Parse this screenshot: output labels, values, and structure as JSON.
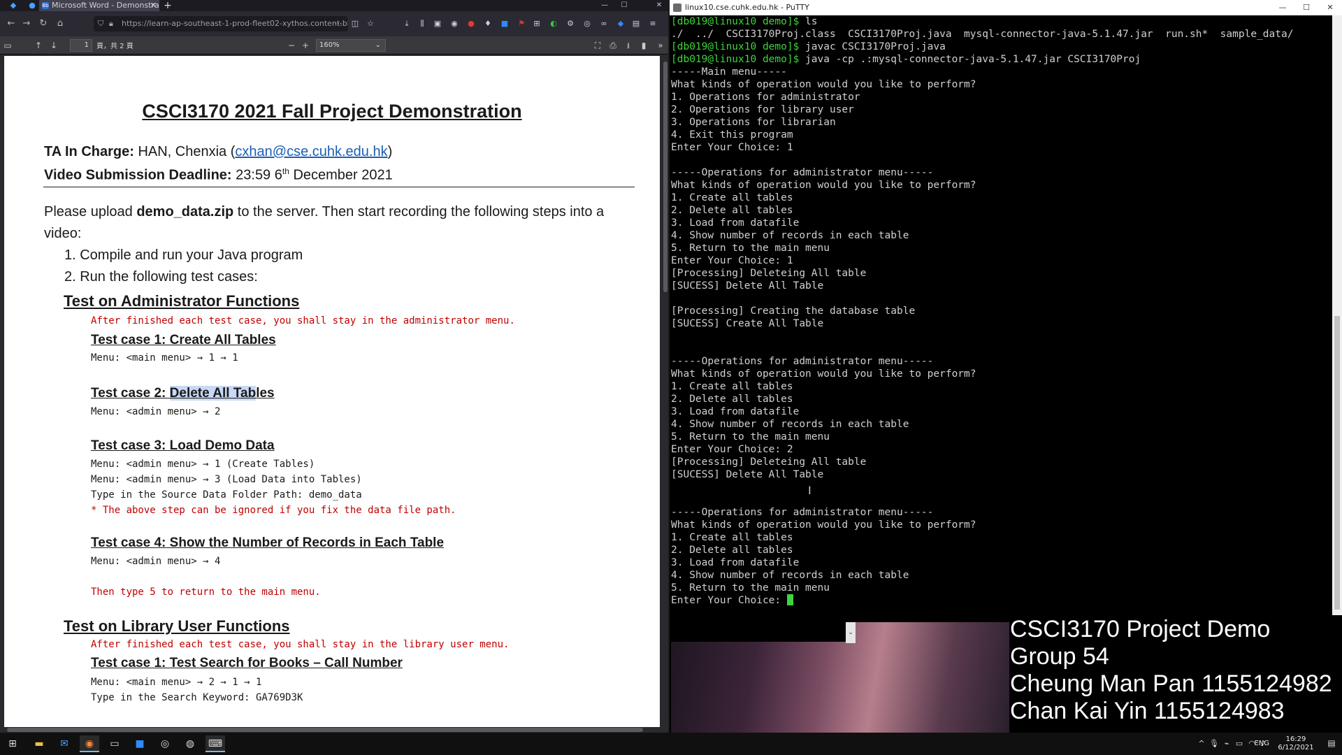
{
  "firefox": {
    "tab_title": "Microsoft Word - Demonstra",
    "url": "https://learn-ap-southeast-1-prod-fleet02-xythos.content.bl",
    "pdf": {
      "page_number": "1",
      "page_count": "頁，共 2 頁",
      "zoom": "160%"
    }
  },
  "doc": {
    "title": "CSCI3170 2021 Fall Project Demonstration",
    "ta_label": "TA In Charge:",
    "ta_name": " HAN, Chenxia (",
    "ta_email": "cxhan@cse.cuhk.edu.hk",
    "ta_close": ")",
    "deadline_label": "Video Submission Deadline:",
    "deadline_value": " 23:59 6",
    "deadline_sup": "th",
    "deadline_tail": " December 2021",
    "intro_1": "Please upload ",
    "intro_bold": "demo_data.zip",
    "intro_2": " to the server. Then start recording the following steps into a",
    "intro_3": "video:",
    "steps": [
      "1.  Compile and run your Java program",
      "2.  Run the following test cases:"
    ],
    "admin_section": "Test on Administrator Functions",
    "admin_note": "After finished each test case, you shall stay in the administrator menu.",
    "tc1_title": "Test case 1: Create All Tables",
    "tc1_menu": "Menu: <main menu> → 1 → 1",
    "tc2_title_a": "Test case 2: ",
    "tc2_title_hl": "Delete All Tab",
    "tc2_title_b": "les",
    "tc2_menu": "Menu: <admin menu> → 2",
    "tc3_title": "Test case 3: Load Demo Data",
    "tc3_menu1": "Menu: <admin menu> → 1 (Create Tables)",
    "tc3_menu2": "Menu: <admin menu> → 3 (Load Data into Tables)",
    "tc3_path": "Type in the Source Data Folder Path: demo_data",
    "tc3_note": "* The above step can be ignored if you fix the data file path.",
    "tc4_title": "Test case 4: Show the Number of Records in Each Table",
    "tc4_menu": "Menu: <admin menu> → 4",
    "tc4_note": "Then type 5 to return to the main menu.",
    "user_section": "Test on Library User Functions",
    "user_note": "After finished each test case, you shall stay in the library user menu.",
    "utc1_title": "Test case 1: Test Search for Books – Call Number",
    "utc1_menu": "Menu: <main menu> → 2 → 1 → 1",
    "utc1_kw": "Type in the Search Keyword: GA769D3K"
  },
  "putty": {
    "title": "linux10.cse.cuhk.edu.hk - PuTTY",
    "lines": [
      "[db019@linux10 demo]$ ls",
      "./  ../  CSCI3170Proj.class  CSCI3170Proj.java  mysql-connector-java-5.1.47.jar  run.sh*  sample_data/",
      "[db019@linux10 demo]$ javac CSCI3170Proj.java",
      "[db019@linux10 demo]$ java -cp .:mysql-connector-java-5.1.47.jar CSCI3170Proj",
      "-----Main menu-----",
      "What kinds of operation would you like to perform?",
      "1. Operations for administrator",
      "2. Operations for library user",
      "3. Operations for librarian",
      "4. Exit this program",
      "Enter Your Choice: 1",
      "",
      "-----Operations for administrator menu-----",
      "What kinds of operation would you like to perform?",
      "1. Create all tables",
      "2. Delete all tables",
      "3. Load from datafile",
      "4. Show number of records in each table",
      "5. Return to the main menu",
      "Enter Your Choice: 1",
      "[Processing] Deleteing All table",
      "[SUCESS] Delete All Table",
      "",
      "[Processing] Creating the database table",
      "[SUCESS] Create All Table",
      "",
      "",
      "-----Operations for administrator menu-----",
      "What kinds of operation would you like to perform?",
      "1. Create all tables",
      "2. Delete all tables",
      "3. Load from datafile",
      "4. Show number of records in each table",
      "5. Return to the main menu",
      "Enter Your Choice: 2",
      "[Processing] Deleteing All table",
      "[SUCESS] Delete All Table",
      "",
      "",
      "-----Operations for administrator menu-----",
      "What kinds of operation would you like to perform?",
      "1. Create all tables",
      "2. Delete all tables",
      "3. Load from datafile",
      "4. Show number of records in each table",
      "5. Return to the main menu"
    ],
    "prompt": "Enter Your Choice: ",
    "prompt_user": "[db019@linux10 demo]$"
  },
  "overlay": {
    "line1": "CSCI3170 Project Demo",
    "line2": "Group 54",
    "line3": "Cheung Man Pan 1155124982",
    "line4": "Chan Kai Yin 1155124983"
  },
  "taskbar": {
    "lang": "ENG",
    "time": "16:29",
    "date": "6/12/2021"
  },
  "colors": {
    "terminal_prompt": "#3dd43d",
    "link": "#1a5fb4",
    "note_red": "#c00000"
  }
}
